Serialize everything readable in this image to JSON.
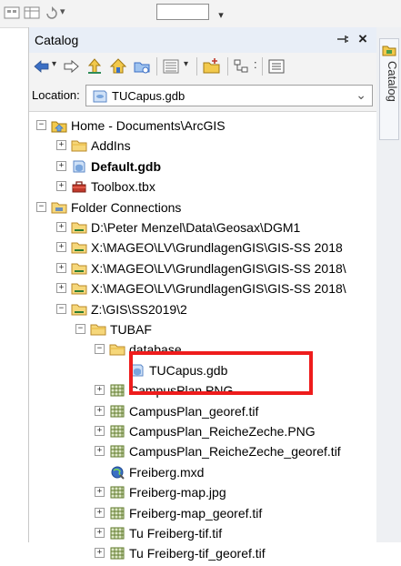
{
  "panel": {
    "title": "Catalog",
    "pin_glyph": "⭾",
    "close_glyph": "×"
  },
  "location": {
    "label": "Location:",
    "value": "TUCapus.gdb"
  },
  "side_tab": {
    "label": "Catalog"
  },
  "tree": [
    {
      "label": "Home - Documents\\ArcGIS",
      "icon": "home-folder-icon",
      "level": 0,
      "expander": "minus",
      "bold": false
    },
    {
      "label": "AddIns",
      "icon": "folder-icon",
      "level": 1,
      "expander": "plus",
      "bold": false
    },
    {
      "label": "Default.gdb",
      "icon": "geodatabase-icon",
      "level": 1,
      "expander": "plus",
      "bold": true
    },
    {
      "label": "Toolbox.tbx",
      "icon": "toolbox-icon",
      "level": 1,
      "expander": "plus",
      "bold": false
    },
    {
      "label": "Folder Connections",
      "icon": "folder-connections-icon",
      "level": 0,
      "expander": "minus",
      "bold": false
    },
    {
      "label": "D:\\Peter Menzel\\Data\\Geosax\\DGM1",
      "icon": "folder-connection-icon",
      "level": 1,
      "expander": "plus",
      "bold": false
    },
    {
      "label": "X:\\MAGEO\\LV\\GrundlagenGIS\\GIS-SS 2018",
      "icon": "folder-connection-icon",
      "level": 1,
      "expander": "plus",
      "bold": false
    },
    {
      "label": "X:\\MAGEO\\LV\\GrundlagenGIS\\GIS-SS 2018\\",
      "icon": "folder-connection-icon",
      "level": 1,
      "expander": "plus",
      "bold": false
    },
    {
      "label": "X:\\MAGEO\\LV\\GrundlagenGIS\\GIS-SS 2018\\",
      "icon": "folder-connection-icon",
      "level": 1,
      "expander": "plus",
      "bold": false
    },
    {
      "label": "Z:\\GIS\\SS2019\\2",
      "icon": "folder-connection-icon",
      "level": 1,
      "expander": "minus",
      "bold": false
    },
    {
      "label": "TUBAF",
      "icon": "folder-icon",
      "level": 2,
      "expander": "minus",
      "bold": false
    },
    {
      "label": "database",
      "icon": "folder-icon",
      "level": 3,
      "expander": "minus",
      "bold": false
    },
    {
      "label": "TUCapus.gdb",
      "icon": "geodatabase-icon",
      "level": 4,
      "expander": "none",
      "bold": false
    },
    {
      "label": "CampusPlan.PNG",
      "icon": "raster-icon",
      "level": 3,
      "expander": "plus",
      "bold": false
    },
    {
      "label": "CampusPlan_georef.tif",
      "icon": "raster-icon",
      "level": 3,
      "expander": "plus",
      "bold": false
    },
    {
      "label": "CampusPlan_ReicheZeche.PNG",
      "icon": "raster-icon",
      "level": 3,
      "expander": "plus",
      "bold": false
    },
    {
      "label": "CampusPlan_ReicheZeche_georef.tif",
      "icon": "raster-icon",
      "level": 3,
      "expander": "plus",
      "bold": false
    },
    {
      "label": "Freiberg.mxd",
      "icon": "map-document-icon",
      "level": 3,
      "expander": "none",
      "bold": false
    },
    {
      "label": "Freiberg-map.jpg",
      "icon": "raster-icon",
      "level": 3,
      "expander": "plus",
      "bold": false
    },
    {
      "label": "Freiberg-map_georef.tif",
      "icon": "raster-icon",
      "level": 3,
      "expander": "plus",
      "bold": false
    },
    {
      "label": "Tu Freiberg-tif.tif",
      "icon": "raster-icon",
      "level": 3,
      "expander": "plus",
      "bold": false
    },
    {
      "label": "Tu Freiberg-tif_georef.tif",
      "icon": "raster-icon",
      "level": 3,
      "expander": "plus",
      "bold": false
    }
  ],
  "colors": {
    "highlight": "#ee1c1c",
    "folder": "#f2c94c",
    "header_bg": "#e8eef7"
  }
}
